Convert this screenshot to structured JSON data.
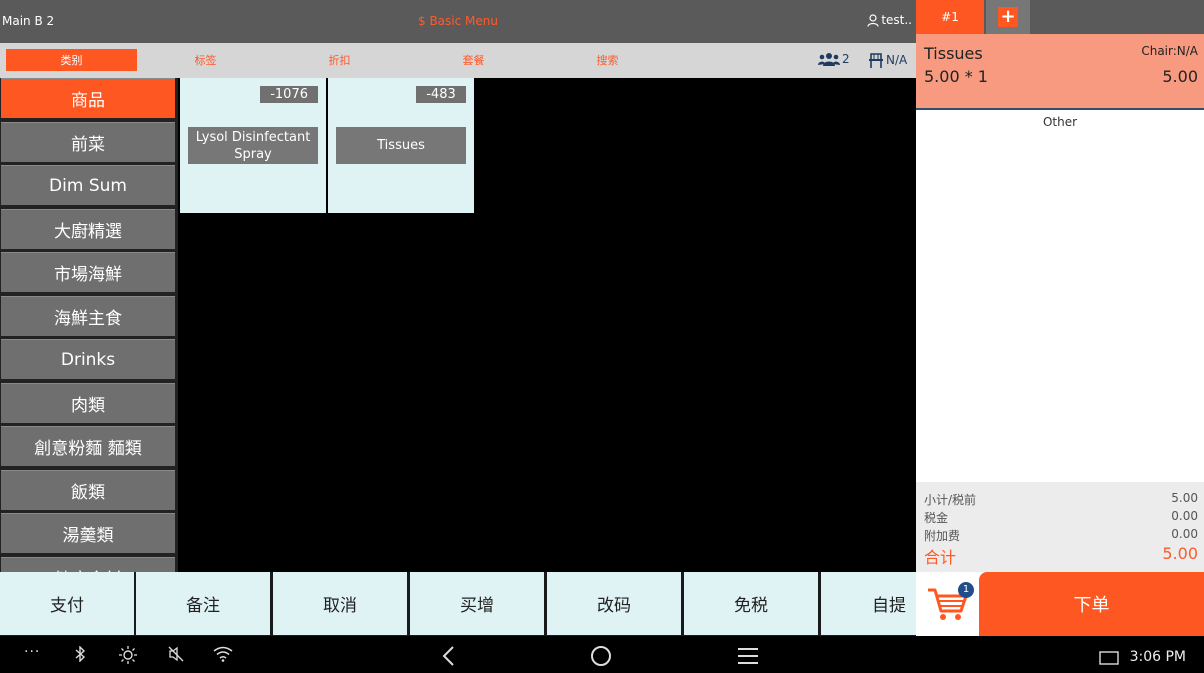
{
  "header": {
    "station": "Main B 2",
    "menu_name": "$ Basic Menu",
    "user": "test.."
  },
  "tabs": [
    "类别",
    "标签",
    "折扣",
    "套餐",
    "搜索"
  ],
  "status": {
    "guests": "2",
    "chair": "N/A"
  },
  "categories": [
    "商品",
    "前菜",
    "Dim Sum",
    "大廚精選",
    "市場海鮮",
    "海鮮主食",
    "Drinks",
    "肉類",
    "創意粉麵 麵類",
    "飯類",
    "湯羹類",
    "健康食材"
  ],
  "items": [
    {
      "code": "-1076",
      "name": "Lysol Disinfectant Spray"
    },
    {
      "code": "-483",
      "name": "Tissues"
    }
  ],
  "actions": [
    "支付",
    "备注",
    "取消",
    "买增",
    "改码",
    "免税",
    "自提"
  ],
  "order": {
    "tab": "#1",
    "line": {
      "name": "Tissues",
      "chair": "Chair:N/A",
      "qty": "5.00 * 1",
      "price": "5.00"
    },
    "section": "Other",
    "totals": {
      "subtotal_label": "小计/税前",
      "subtotal": "5.00",
      "tax_label": "税金",
      "tax": "0.00",
      "surcharge_label": "附加费",
      "surcharge": "0.00",
      "total_label": "合计",
      "total": "5.00"
    },
    "cart_count": "1",
    "submit_label": "下单"
  },
  "system": {
    "time": "3:06 PM"
  },
  "colors": {
    "accent": "#ff5722",
    "tile_bg": "#dff2f4",
    "category_bg": "#6f6f6f"
  }
}
